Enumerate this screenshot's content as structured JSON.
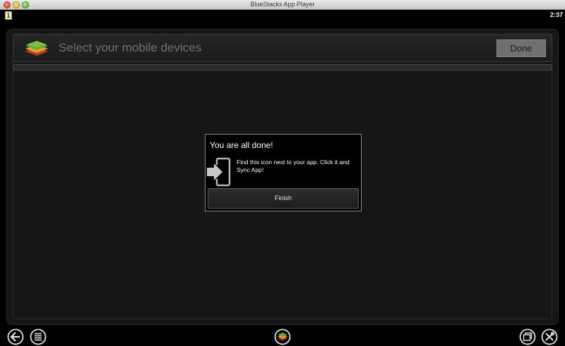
{
  "window": {
    "title": "BlueStacks App Player"
  },
  "statusbar": {
    "notification": "1",
    "clock": "2:37"
  },
  "header": {
    "title": "Select your mobile devices",
    "done_label": "Done"
  },
  "dialog": {
    "title": "You are all done!",
    "message": "Find this icon next to your app. Click it and Sync App!",
    "finish_label": "Finish"
  },
  "icons": {
    "back": "back-arrow-icon",
    "menu": "menu-list-icon",
    "home": "bluestacks-home-icon",
    "window": "window-mode-icon",
    "settings": "settings-tools-icon"
  }
}
